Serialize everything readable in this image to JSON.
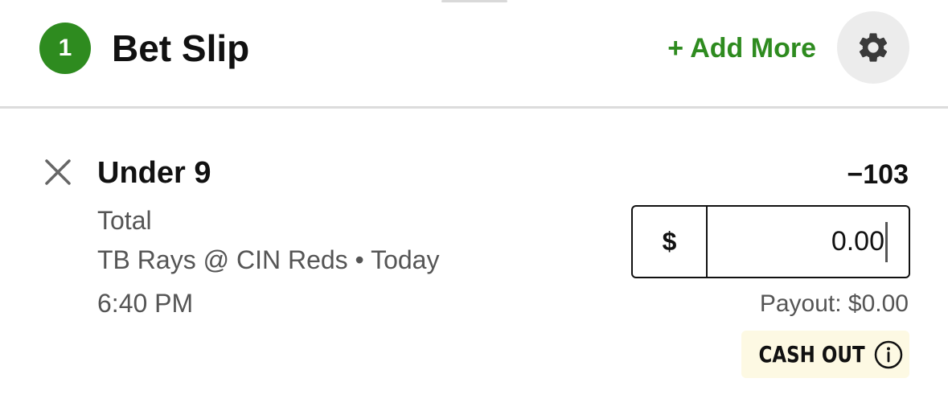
{
  "header": {
    "bet_count": "1",
    "title": "Bet Slip",
    "add_more_label": "+ Add More",
    "settings_icon": "gear-icon"
  },
  "bet": {
    "remove_icon": "close-icon",
    "selection": "Under 9",
    "market": "Total",
    "event": "TB Rays @ CIN Reds • Today",
    "time": "6:40 PM",
    "odds": "−103",
    "currency_symbol": "$",
    "wager_value": "0.00",
    "payout": "Payout: $0.00",
    "cashout_label": "CASH OUT",
    "info_icon": "info-icon"
  },
  "colors": {
    "accent_green": "#2e8b1f",
    "cashout_background": "#fdf9e3",
    "divider": "#dcdcdc"
  }
}
